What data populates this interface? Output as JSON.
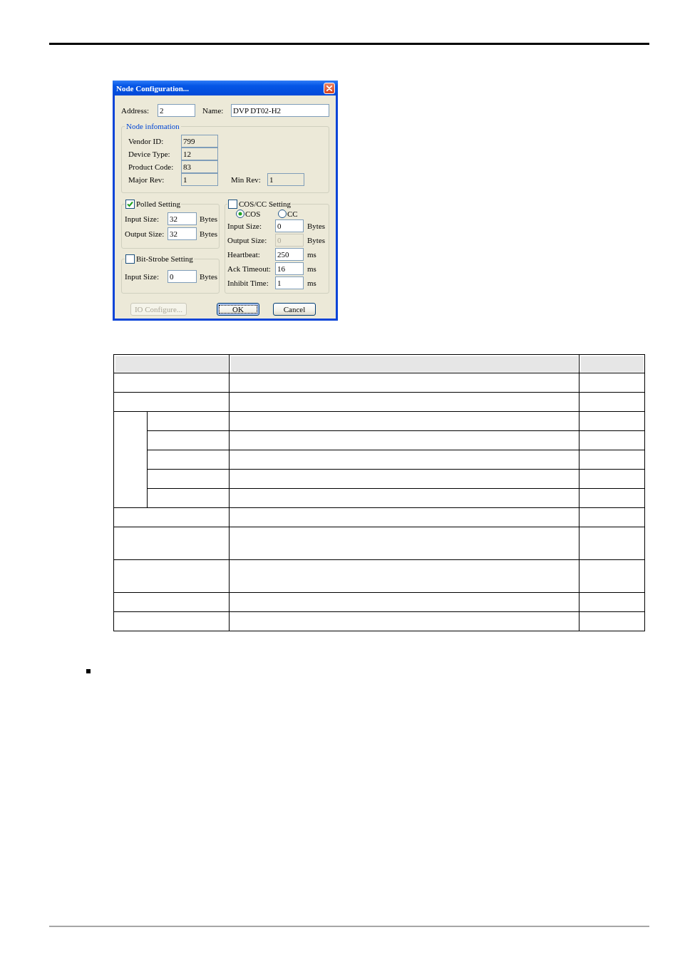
{
  "dialog": {
    "title": "Node Configuration...",
    "address": {
      "label": "Address:",
      "value": "2"
    },
    "name": {
      "label": "Name:",
      "value": "DVP DT02-H2"
    },
    "node_information": {
      "legend": "Node infomation",
      "fields": [
        {
          "label": "Vendor ID:",
          "value": "799"
        },
        {
          "label": "Device Type:",
          "value": "12"
        },
        {
          "label": "Product Code:",
          "value": "83"
        },
        {
          "label": "Major Rev:",
          "value": "1"
        }
      ],
      "min_rev": {
        "label": "Min Rev:",
        "value": "1"
      }
    },
    "polled_setting": {
      "label": "Polled Setting",
      "checked": true,
      "fields": [
        {
          "label": "Input Size:",
          "value": "32",
          "unit": "Bytes"
        },
        {
          "label": "Output Size:",
          "value": "32",
          "unit": "Bytes"
        }
      ]
    },
    "bit_strobe_setting": {
      "label": "Bit-Strobe Setting",
      "checked": false,
      "fields": [
        {
          "label": "Input Size:",
          "value": "0",
          "unit": "Bytes"
        }
      ]
    },
    "cos_cc_setting": {
      "label": "COS/CC Setting",
      "checked": false,
      "modes": [
        {
          "label": "COS",
          "selected": true
        },
        {
          "label": "CC",
          "selected": false
        }
      ],
      "fields": [
        {
          "label": "Input Size:",
          "value": "0",
          "unit": "Bytes",
          "disabled": false
        },
        {
          "label": "Output Size:",
          "value": "0",
          "unit": "Bytes",
          "disabled": true
        },
        {
          "label": "Heartbeat:",
          "value": "250",
          "unit": "ms",
          "disabled": false
        },
        {
          "label": "Ack Timeout:",
          "value": "16",
          "unit": "ms",
          "disabled": false
        },
        {
          "label": "Inhibit Time:",
          "value": "1",
          "unit": "ms",
          "disabled": false
        }
      ]
    },
    "buttons": [
      {
        "label": "IO Configure...",
        "disabled": true,
        "focused": false
      },
      {
        "label": "OK",
        "disabled": false,
        "focused": true
      },
      {
        "label": "Cancel",
        "disabled": false,
        "focused": false
      }
    ]
  },
  "table": {
    "rows": [
      {
        "kind": "plain"
      },
      {
        "kind": "plain"
      },
      {
        "kind": "split"
      },
      {
        "kind": "split"
      },
      {
        "kind": "split"
      },
      {
        "kind": "split"
      },
      {
        "kind": "split"
      },
      {
        "kind": "plain"
      },
      {
        "kind": "tall"
      },
      {
        "kind": "tall"
      },
      {
        "kind": "plain"
      },
      {
        "kind": "plain"
      }
    ]
  }
}
